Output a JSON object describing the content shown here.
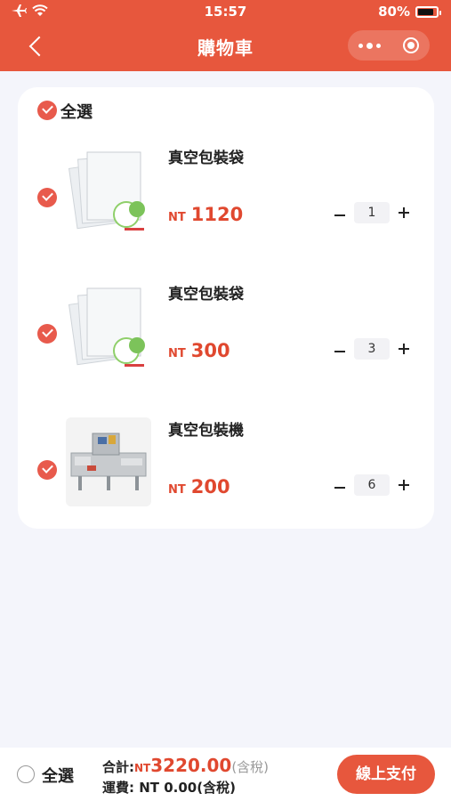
{
  "status_bar": {
    "time": "15:57",
    "battery": "80%"
  },
  "nav": {
    "title": "購物車"
  },
  "cart": {
    "select_all_label": "全選",
    "items": [
      {
        "name": "真空包裝袋",
        "currency": "NT",
        "price": "1120",
        "quantity": "1",
        "image": "vacuum-bag"
      },
      {
        "name": "真空包裝袋",
        "currency": "NT",
        "price": "300",
        "quantity": "3",
        "image": "vacuum-bag"
      },
      {
        "name": "真空包裝機",
        "currency": "NT",
        "price": "200",
        "quantity": "6",
        "image": "packaging-machine"
      }
    ]
  },
  "footer": {
    "select_all_label": "全選",
    "total_label": "合計:",
    "total_currency": "NT",
    "total_amount": "3220.00",
    "total_tax_note": "(含稅)",
    "shipping_text": "運費: NT 0.00(含稅)",
    "pay_button": "線上支付"
  },
  "colors": {
    "accent": "#e7573d",
    "price": "#e0482f",
    "check": "#e85a4c",
    "background": "#f4f5fb"
  }
}
